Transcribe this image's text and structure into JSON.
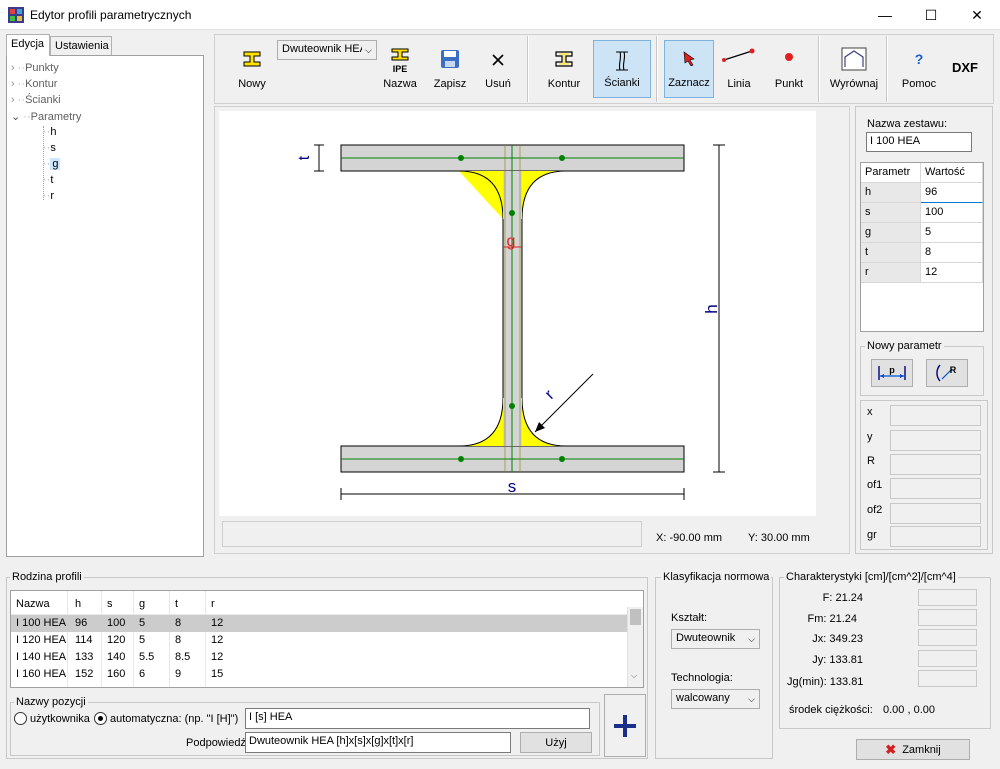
{
  "window": {
    "title": "Edytor profili parametrycznych"
  },
  "tabs": [
    "Edycja",
    "Ustawienia"
  ],
  "tree": {
    "items": [
      "Punkty",
      "Kontur",
      "Ścianki",
      "Parametry"
    ],
    "params": [
      "h",
      "s",
      "g",
      "t",
      "r"
    ],
    "selected": "g"
  },
  "toolbar": {
    "new_label": "Nowy",
    "profile_select": "Dwuteownik HEA",
    "name_label": "Nazwa",
    "name_icon_text": "IPE",
    "save_label": "Zapisz",
    "delete_label": "Usuń",
    "contour_label": "Kontur",
    "walls_label": "Ścianki",
    "select_label": "Zaznacz",
    "line_label": "Linia",
    "point_label": "Punkt",
    "align_label": "Wyrównaj",
    "help_label": "Pomoc",
    "dxf_label": "DXF"
  },
  "drawing": {
    "dim_t": "t",
    "dim_h": "h",
    "dim_s": "s",
    "dim_g": "g",
    "dim_r": "r"
  },
  "status": {
    "x": "X:  -90.00 mm",
    "y": "Y:  30.00 mm"
  },
  "set_panel": {
    "name_label": "Nazwa zestawu:",
    "name_value": "I 100 HEA",
    "col_param": "Parametr",
    "col_value": "Wartość",
    "params": [
      {
        "name": "h",
        "value": "96"
      },
      {
        "name": "s",
        "value": "100"
      },
      {
        "name": "g",
        "value": "5"
      },
      {
        "name": "t",
        "value": "8"
      },
      {
        "name": "r",
        "value": "12"
      }
    ],
    "new_param_label": "Nowy parametr",
    "new_param_p": "p",
    "new_param_r": "R"
  },
  "coords": {
    "labels": [
      "x",
      "y",
      "R",
      "of1",
      "of2",
      "gr"
    ]
  },
  "family": {
    "label": "Rodzina profili",
    "headers": [
      "Nazwa",
      "h",
      "s",
      "g",
      "t",
      "r"
    ],
    "rows": [
      [
        "I 100 HEA",
        "96",
        "100",
        "5",
        "8",
        "12"
      ],
      [
        "I 120 HEA",
        "114",
        "120",
        "5",
        "8",
        "12"
      ],
      [
        "I 140 HEA",
        "133",
        "140",
        "5.5",
        "8.5",
        "12"
      ],
      [
        "I 160 HEA",
        "152",
        "160",
        "6",
        "9",
        "15"
      ]
    ]
  },
  "positions": {
    "label": "Nazwy pozycji",
    "user_option": "użytkownika",
    "auto_option": "automatyczna: (np. \"I [H]\")",
    "auto_value": "I [s] HEA",
    "hint_label": "Podpowiedź",
    "hint_value": "Dwuteownik HEA [h]x[s]x[g]x[t]x[r]",
    "use_button": "Użyj"
  },
  "classification": {
    "label": "Klasyfikacja normowa",
    "shape_label": "Kształt:",
    "shape_value": "Dwuteownik",
    "tech_label": "Technologia:",
    "tech_value": "walcowany"
  },
  "characteristics": {
    "label": "Charakterystyki [cm]/[cm^2]/[cm^4]",
    "rows": [
      "F: 21.24",
      "Fm: 21.24",
      "Jx: 349.23",
      "Jy: 133.81",
      "Jg(min): 133.81"
    ],
    "center_label": "środek ciężkości:",
    "center_value": "0.00 , 0.00"
  },
  "close_button": "Zamknij",
  "colors": {
    "accent": "#0078d7",
    "fillet": "#ffff00",
    "section": "#d4d4d4",
    "axis": "#008000"
  }
}
